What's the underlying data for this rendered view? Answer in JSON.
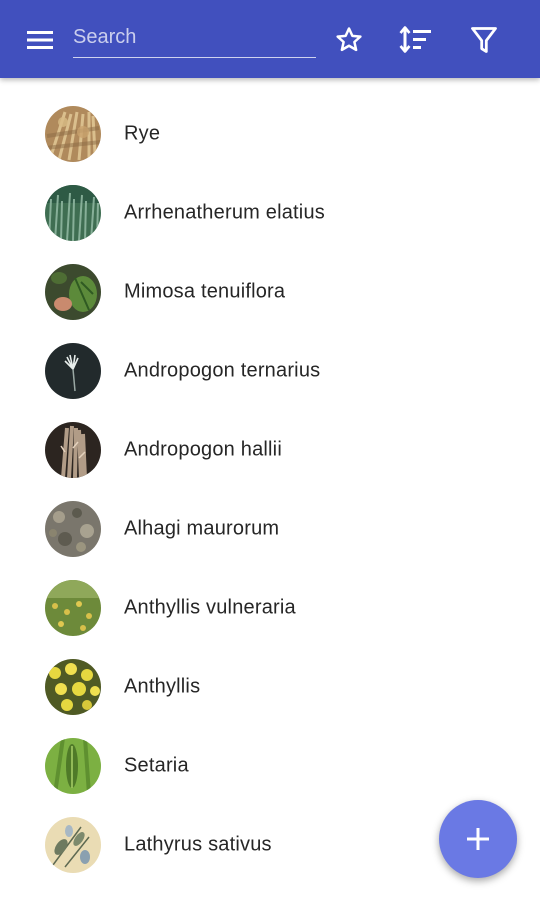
{
  "toolbar": {
    "menu_icon": "hamburger-menu-icon",
    "search_placeholder": "Search",
    "search_value": "",
    "favorites_icon": "star-outline-icon",
    "sort_icon": "sort-icon",
    "filter_icon": "filter-icon",
    "color": "#4150be"
  },
  "plants": [
    {
      "name": "Rye",
      "thumb": "rye-photo"
    },
    {
      "name": "Arrhenatherum elatius",
      "thumb": "arrhenatherum-elatius-photo"
    },
    {
      "name": "Mimosa tenuiflora",
      "thumb": "mimosa-tenuiflora-photo"
    },
    {
      "name": "Andropogon ternarius",
      "thumb": "andropogon-ternarius-photo"
    },
    {
      "name": "Andropogon hallii",
      "thumb": "andropogon-hallii-photo"
    },
    {
      "name": "Alhagi maurorum",
      "thumb": "alhagi-maurorum-photo"
    },
    {
      "name": "Anthyllis vulneraria",
      "thumb": "anthyllis-vulneraria-photo"
    },
    {
      "name": "Anthyllis",
      "thumb": "anthyllis-photo"
    },
    {
      "name": "Setaria",
      "thumb": "setaria-photo"
    },
    {
      "name": "Lathyrus sativus",
      "thumb": "lathyrus-sativus-photo"
    }
  ],
  "fab": {
    "icon": "plus-icon",
    "color": "#6a79e4"
  }
}
